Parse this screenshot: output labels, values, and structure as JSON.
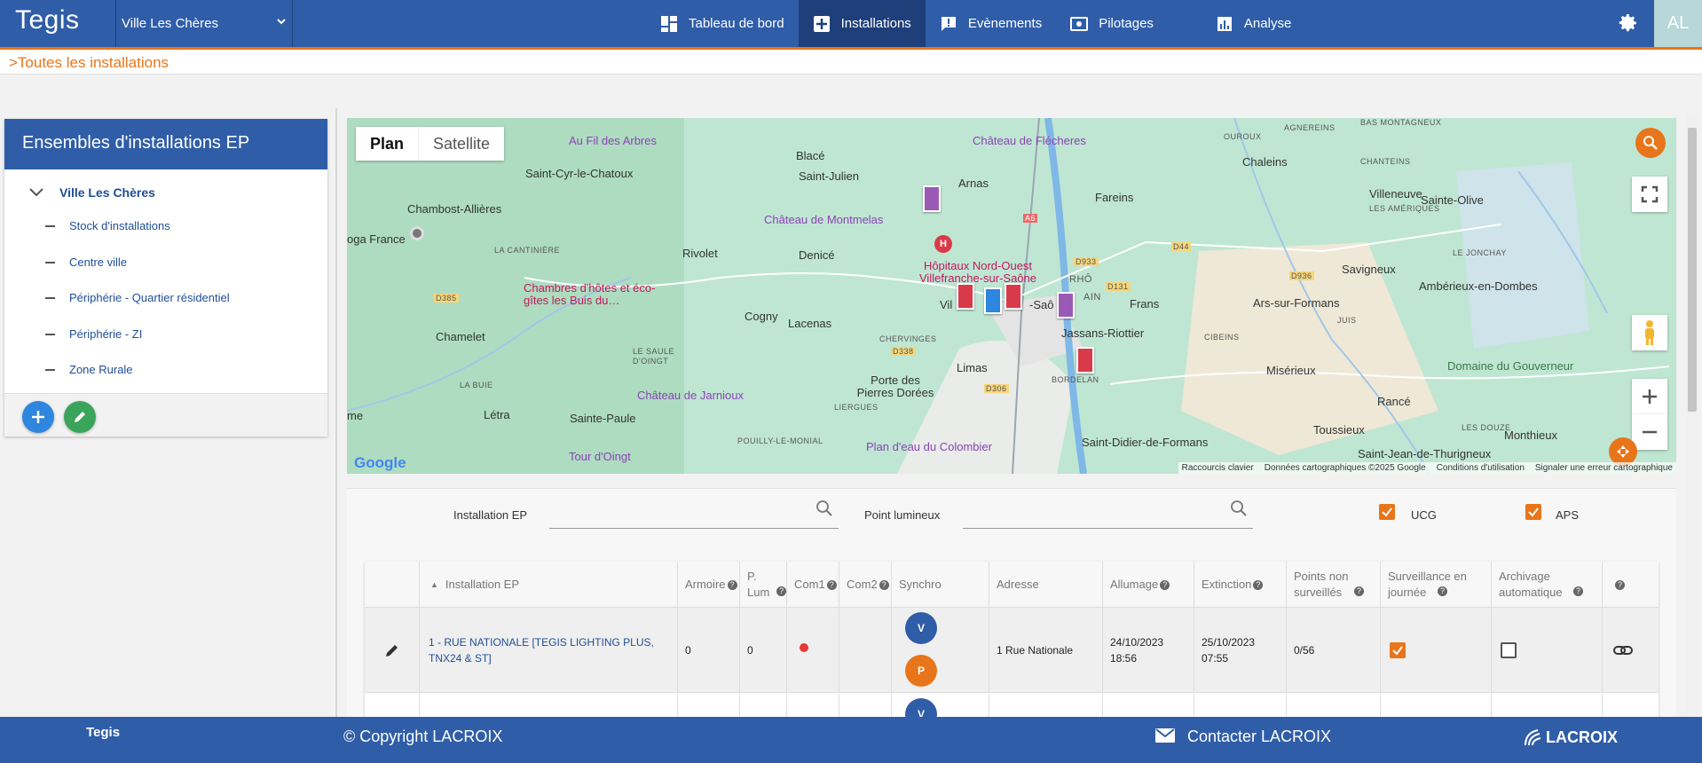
{
  "app": {
    "brand": "Tegis",
    "site": "Ville Les Chères",
    "avatar": "AL"
  },
  "nav": {
    "items": [
      {
        "label": "Tableau de bord",
        "icon": "dashboard-icon"
      },
      {
        "label": "Installations",
        "icon": "installations-icon",
        "active": true
      },
      {
        "label": "Evènements",
        "icon": "alert-icon"
      },
      {
        "label": "Pilotages",
        "icon": "control-icon"
      },
      {
        "label": "Analyse",
        "icon": "chart-icon"
      }
    ]
  },
  "breadcrumb": ">Toutes les installations",
  "left_panel": {
    "title": "Ensembles d'installations EP",
    "root": "Ville Les Chères",
    "items": [
      "Stock d'installations",
      "Centre ville",
      "Périphérie - Quartier résidentiel",
      "Périphérie - ZI",
      "Zone Rurale"
    ]
  },
  "map": {
    "tabs": {
      "plan": "Plan",
      "satellite": "Satellite"
    },
    "places": [
      "Saint-Cyr-le-Chatoux",
      "Chambost-Allières",
      "Blacé",
      "Saint-Julien",
      "Arnas",
      "Rivolet",
      "Denicé",
      "Cogny",
      "Lacenas",
      "Chamelet",
      "Létra",
      "Sainte-Paule",
      "Porte des Pierres Dorées",
      "Limas",
      "Chaleins",
      "Fareins",
      "Villeneuve",
      "Sainte-Olive",
      "Savigneux",
      "Frans",
      "Jassans-Riottier",
      "Ars-sur-Formans",
      "Ambérieux-en-Dombes",
      "Misérieux",
      "Rancé",
      "Toussieux",
      "Saint-Didier-de-Formans",
      "Saint-Jean-de-Thurigneux",
      "Monthieux",
      "Vil",
      "-Saô",
      "oga France",
      "me"
    ],
    "pois": [
      "Au Fil des Arbres",
      "Château de Flécheres",
      "Château de Montmelas",
      "Hôpitaux Nord-Ouest Villefranche-sur-Saône",
      "Chambres d'hôtes et éco-gîtes les Buis du…",
      "Château de Jarnioux",
      "Tour d'Oingt",
      "Plan d'eau du Colombier",
      "Domaine du Gouverneur"
    ],
    "small_labels": [
      "BAS MONTAGNEUX",
      "AGNEREINS",
      "OUROUX",
      "CHANTEINS",
      "LES AMÉRIQUES",
      "LE JONCHAY",
      "LA CANTINIÈRE",
      "CHERVINGES",
      "LE SAULE D'OINGT",
      "LA BUIE",
      "LIERGUES",
      "POUILLY-LE-MONIAL",
      "CIBEINS",
      "BORDELAN",
      "JUIS",
      "LES DOUZE",
      "D385",
      "D933",
      "D44",
      "D936",
      "D131",
      "D338",
      "D306",
      "A6",
      "RHÔ",
      "AIN"
    ],
    "attribution": [
      "Raccourcis clavier",
      "Données cartographiques ©2025 Google",
      "Conditions d'utilisation",
      "Signaler une erreur cartographique"
    ],
    "google": "Google",
    "marker_colors": {
      "red": "#d93a4a",
      "blue": "#2e86de",
      "purple": "#9b59b6"
    }
  },
  "filters": {
    "installation_label": "Installation EP",
    "point_label": "Point lumineux",
    "ucg_label": "UCG",
    "aps_label": "APS"
  },
  "table": {
    "headers": {
      "installation": "Installation EP",
      "armoire": "Armoire",
      "plum": "P. Lum",
      "com1": "Com1",
      "com2": "Com2",
      "synchro": "Synchro",
      "adresse": "Adresse",
      "allumage": "Allumage",
      "extinction": "Extinction",
      "points": "Points non surveillés",
      "surveillance": "Surveillance en journée",
      "archivage": "Archivage automatique"
    },
    "rows": [
      {
        "installation": "1 - RUE NATIONALE [TEGIS LIGHTING PLUS, TNX24 & ST]",
        "armoire": "0",
        "plum": "0",
        "synchro_v": "V",
        "synchro_p": "P",
        "adresse": "1 Rue Nationale",
        "allumage": "24/10/2023 18:56",
        "extinction": "25/10/2023 07:55",
        "points": "0/56",
        "surveillance": true,
        "archivage": false
      }
    ],
    "row2_synchro": "V"
  },
  "footer": {
    "brand": "Tegis",
    "copyright": "© Copyright LACROIX",
    "contact": "Contacter LACROIX",
    "logo": "LACROIX"
  },
  "colors": {
    "primary": "#2f5da8",
    "accent": "#e8751a",
    "active_nav": "#1f3f7a"
  }
}
